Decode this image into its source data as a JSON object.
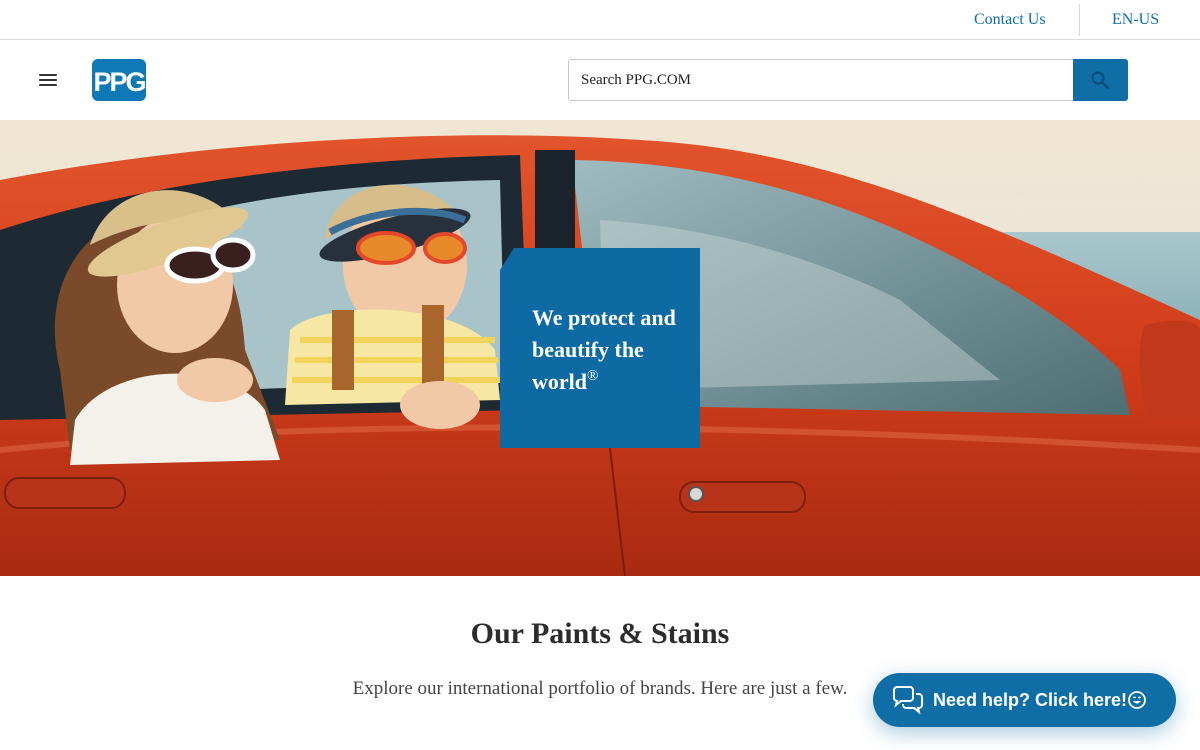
{
  "utility_bar": {
    "contact_label": "Contact Us",
    "language_label": "EN-US"
  },
  "header": {
    "logo_text": "PPG",
    "menu_icon": "hamburger-menu-icon",
    "search": {
      "placeholder": "Search PPG.COM",
      "value": "",
      "button_icon": "search-icon"
    }
  },
  "hero": {
    "tagline_main": "We protect and beautify the world",
    "tagline_mark": "®",
    "image_subject": "children-in-red-car-photo"
  },
  "content": {
    "title": "Our Paints & Stains",
    "subtitle": "Explore our international portfolio of brands. Here are just a few."
  },
  "chat": {
    "label": "Need help? Click here!",
    "icon": "chat-bubbles-icon",
    "emoji_icon": "smile-icon"
  },
  "colors": {
    "brand_blue": "#0f6ea6",
    "card_blue": "#0d6aa3",
    "car_red": "#d9401f"
  }
}
